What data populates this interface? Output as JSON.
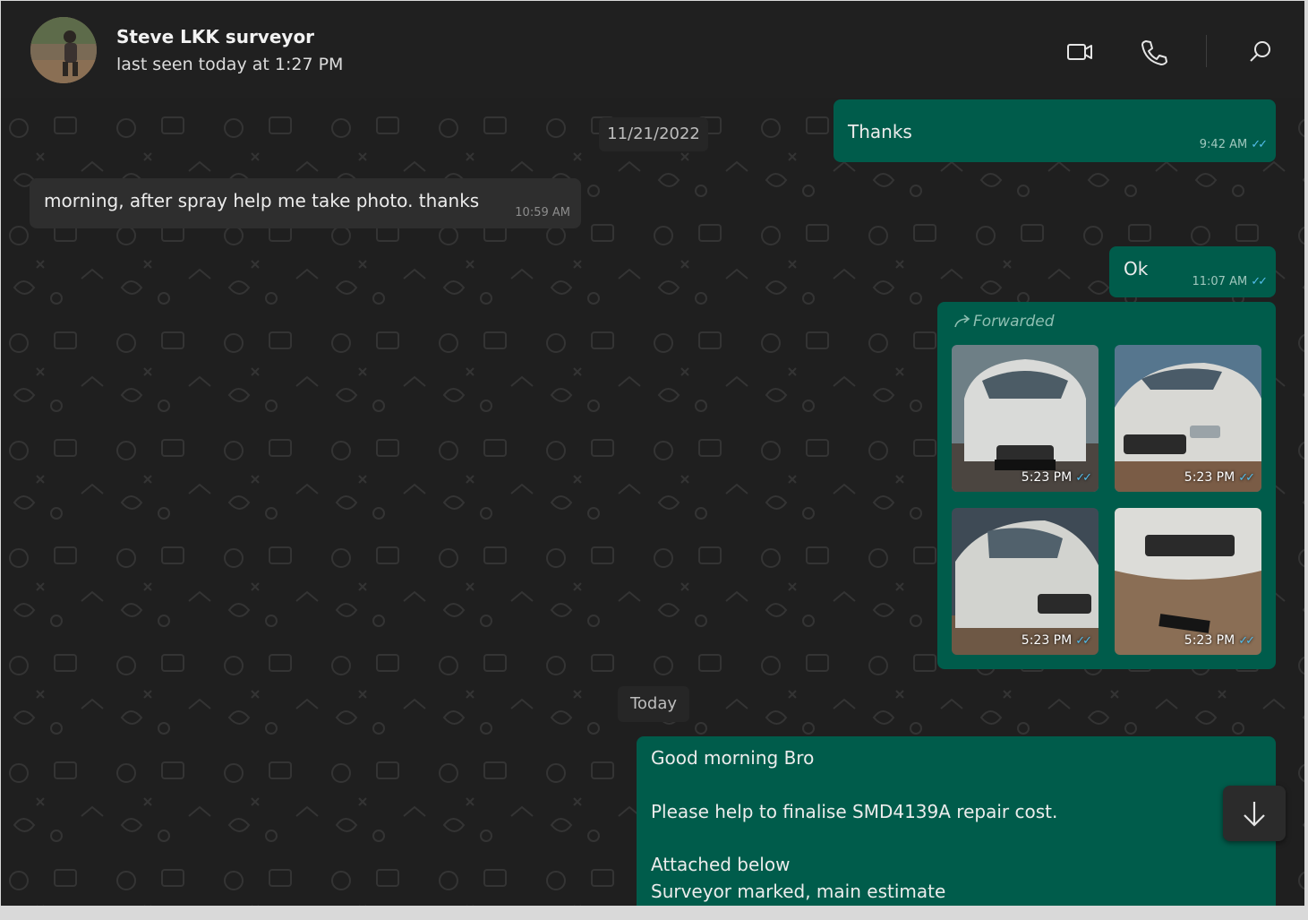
{
  "contact": {
    "name": "Steve LKK surveyor",
    "status": "last seen today at 1:27 PM"
  },
  "header_icons": [
    "video-call-icon",
    "voice-call-icon",
    "search-icon"
  ],
  "date_separators": {
    "first": "11/21/2022",
    "second": "Today"
  },
  "messages": {
    "thanks": {
      "text": "Thanks",
      "time": "9:42 AM",
      "ticks": "✓✓"
    },
    "morning": {
      "text": "morning, after spray help me take photo. thanks",
      "time": "10:59 AM"
    },
    "ok": {
      "text": "Ok",
      "time": "11:07 AM",
      "ticks": "✓✓"
    },
    "forwarded": {
      "label": "Forwarded",
      "photos": [
        {
          "time": "5:23 PM",
          "ticks": "✓✓"
        },
        {
          "time": "5:23 PM",
          "ticks": "✓✓"
        },
        {
          "time": "5:23 PM",
          "ticks": "✓✓"
        },
        {
          "time": "5:23 PM",
          "ticks": "✓✓"
        }
      ]
    },
    "long": {
      "line1": "Good morning Bro",
      "line2": "Please help to finalise SMD4139A repair cost.",
      "line3": "Attached below",
      "line4": "Surveyor marked, main estimate"
    }
  },
  "colors": {
    "outgoing_bubble": "#005c4b",
    "incoming_bubble": "#2e2e2e",
    "background": "#1f1f1f",
    "read_ticks": "#53bdeb"
  }
}
